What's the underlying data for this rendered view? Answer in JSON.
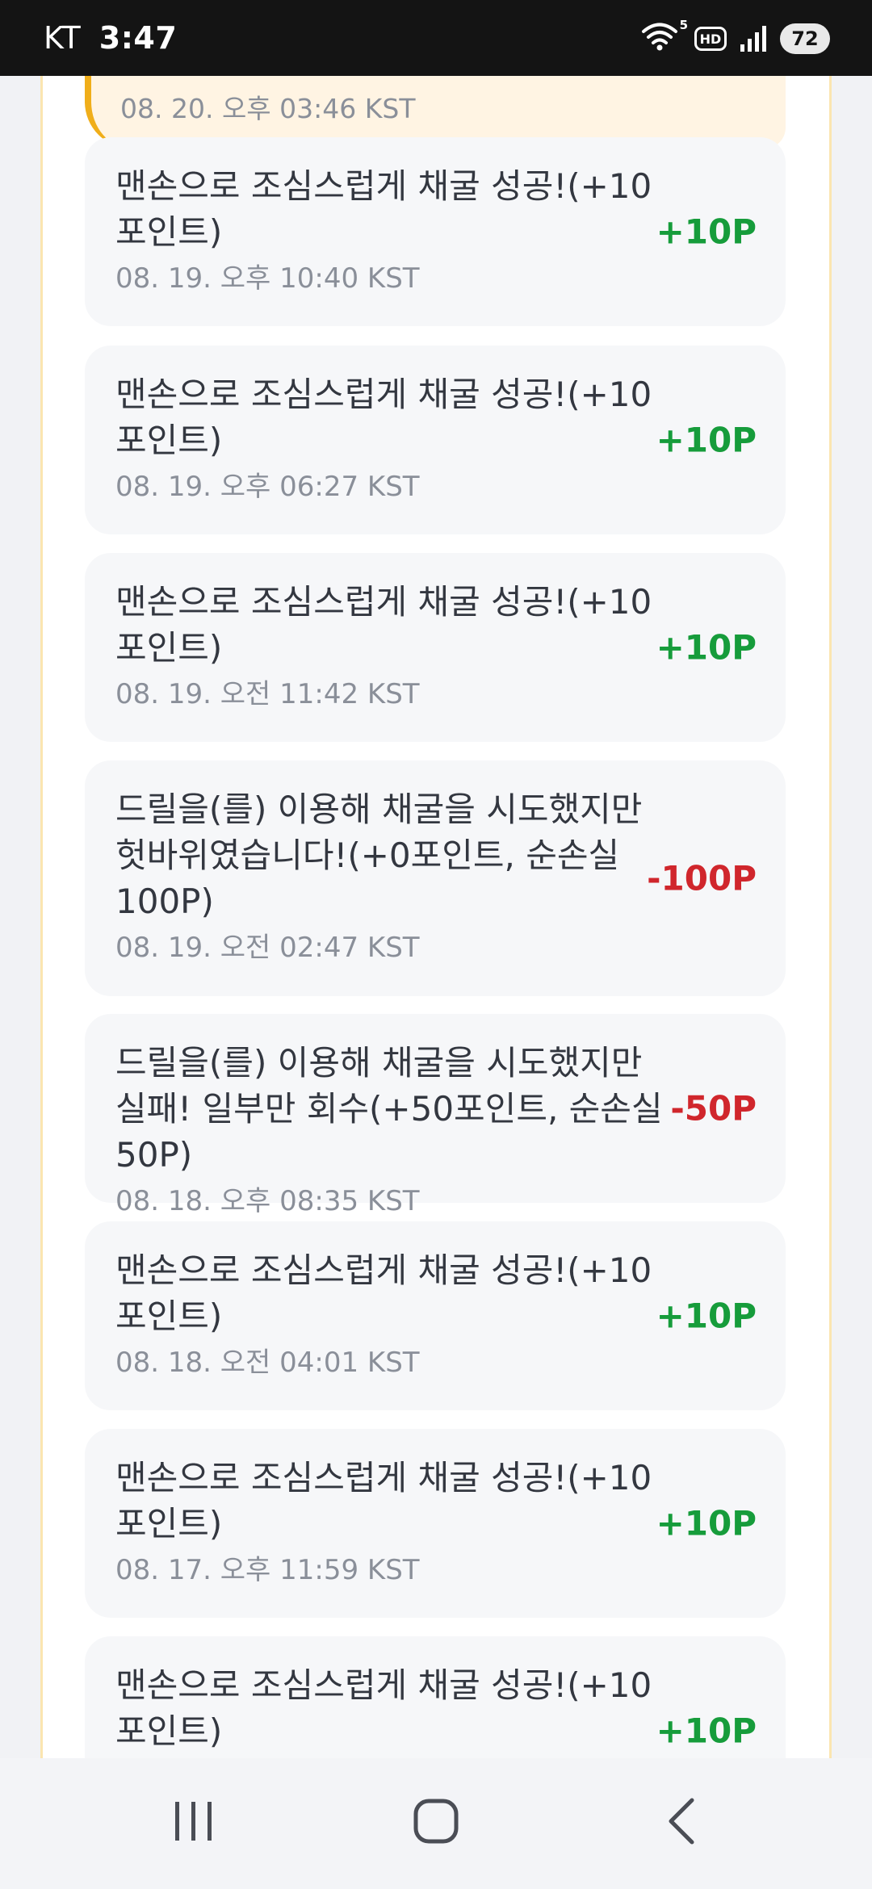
{
  "status_bar": {
    "carrier": "KT",
    "time": "3:47",
    "network_badge": "5",
    "hd_label": "HD",
    "battery": "72"
  },
  "partial_entry": {
    "date": "08. 20. 오후 03:46 KST"
  },
  "entries": [
    {
      "text": "맨손으로 조심스럽게 채굴 성공!(+10포인트)",
      "date": "08. 19. 오후 10:40 KST",
      "amount": "+10P",
      "sign": "positive"
    },
    {
      "text": "맨손으로 조심스럽게 채굴 성공!(+10포인트)",
      "date": "08. 19. 오후 06:27 KST",
      "amount": "+10P",
      "sign": "positive"
    },
    {
      "text": "맨손으로 조심스럽게 채굴 성공!(+10포인트)",
      "date": "08. 19. 오전 11:42 KST",
      "amount": "+10P",
      "sign": "positive"
    },
    {
      "text": "드릴을(를) 이용해 채굴을 시도했지만 헛바위였습니다!(+0포인트, 순손실 100P)",
      "date": "08. 19. 오전 02:47 KST",
      "amount": "-100P",
      "sign": "negative"
    },
    {
      "text": "드릴을(를) 이용해 채굴을 시도했지만 실패! 일부만 회수(+50포인트, 순손실 50P)",
      "date": "08. 18. 오후 08:35 KST",
      "amount": "-50P",
      "sign": "negative"
    },
    {
      "text": "맨손으로 조심스럽게 채굴 성공!(+10포인트)",
      "date": "08. 18. 오전 04:01 KST",
      "amount": "+10P",
      "sign": "positive"
    },
    {
      "text": "맨손으로 조심스럽게 채굴 성공!(+10포인트)",
      "date": "08. 17. 오후 11:59 KST",
      "amount": "+10P",
      "sign": "positive"
    },
    {
      "text": "맨손으로 조심스럽게 채굴 성공!(+10포인트)",
      "date": "",
      "amount": "+10P",
      "sign": "positive"
    }
  ],
  "colors": {
    "positive": "#169c3b",
    "negative": "#d0262c",
    "accent": "#f0ae1a"
  },
  "nav": {
    "icons": [
      "recent-apps-icon",
      "home-icon",
      "back-icon"
    ]
  }
}
